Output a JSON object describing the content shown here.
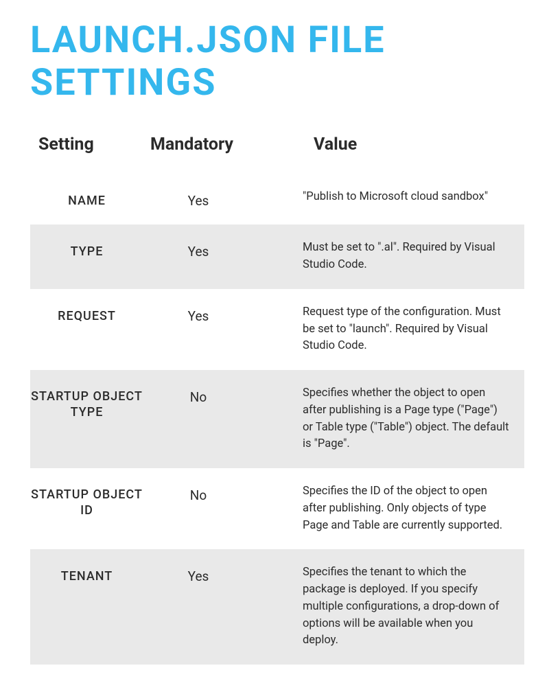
{
  "title": "LAUNCH.JSON FILE SETTINGS",
  "headers": {
    "setting": "Setting",
    "mandatory": "Mandatory",
    "value": "Value"
  },
  "rows": [
    {
      "setting": "NAME",
      "mandatory": "Yes",
      "value": "\"Publish to Microsoft cloud sandbox\""
    },
    {
      "setting": "TYPE",
      "mandatory": "Yes",
      "value": "Must be set to \".al\". Required by Visual Studio Code."
    },
    {
      "setting": "REQUEST",
      "mandatory": "Yes",
      "value": "Request type of the configuration. Must be set to \"launch\". Required by Visual Studio Code."
    },
    {
      "setting": "STARTUP OBJECT TYPE",
      "mandatory": "No",
      "value": "Specifies whether the object to open after publishing is a Page type (\"Page\") or Table type (\"Table\") object. The default is \"Page\"."
    },
    {
      "setting": "STARTUP OBJECT ID",
      "mandatory": "No",
      "value": "Specifies the ID of the object to open after publishing. Only objects of type Page and Table are currently supported."
    },
    {
      "setting": "TENANT",
      "mandatory": "Yes",
      "value": "Specifies the tenant to which the package is deployed. If you specify multiple configurations, a drop-down of options will be available when you deploy."
    }
  ]
}
